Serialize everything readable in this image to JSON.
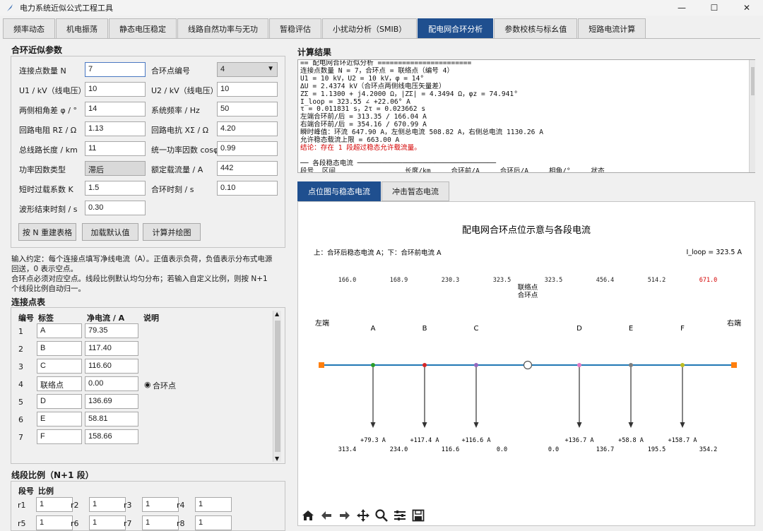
{
  "window": {
    "title": "电力系统近似公式工程工具",
    "buttons": [
      "minimize",
      "maximize",
      "close"
    ]
  },
  "tabs": [
    "频率动态",
    "机电振荡",
    "静态电压稳定",
    "线路自然功率与无功",
    "暂稳评估",
    "小扰动分析（SMIB）",
    "配电网合环分析",
    "参数校核与标幺值",
    "短路电流计算"
  ],
  "active_tab": "配电网合环分析",
  "params": {
    "title": "合环近似参数",
    "fields": [
      {
        "label": "连接点数量 N",
        "value": "7"
      },
      {
        "label": "合环点编号",
        "value": "4"
      },
      {
        "label": "U1 / kV（线电压）",
        "value": "10"
      },
      {
        "label": "U2 / kV（线电压）",
        "value": "10"
      },
      {
        "label": "两侧相角差 φ / °",
        "value": "14"
      },
      {
        "label": "系统频率 / Hz",
        "value": "50"
      },
      {
        "label": "回路电阻 RΣ / Ω",
        "value": "1.13"
      },
      {
        "label": "回路电抗 XΣ / Ω",
        "value": "4.20"
      },
      {
        "label": "总线路长度 / km",
        "value": "11"
      },
      {
        "label": "统一功率因数 cosφ",
        "value": "0.99"
      },
      {
        "label": "功率因数类型",
        "value": "滞后"
      },
      {
        "label": "额定载流量 / A",
        "value": "442"
      },
      {
        "label": "短时过载系数 K",
        "value": "1.5"
      },
      {
        "label": "合环时刻 / s",
        "value": "0.10"
      },
      {
        "label": "波形结束时刻 / s",
        "value": "0.30"
      }
    ],
    "buttons": [
      "按 N 重建表格",
      "加载默认值",
      "计算并绘图"
    ]
  },
  "note": [
    "输入约定：每个连接点填写净线电流（A）。正值表示负荷，负值表示分布式电源",
    "回送，0 表示空点。",
    "合环点必须对应空点。线段比例默认均匀分布；若输入自定义比例，则按 N+1",
    "个线段比例自动归一。"
  ],
  "nodes_table": {
    "title": "连接点表",
    "headers": [
      "编号",
      "标签",
      "净电流 / A",
      "说明"
    ],
    "rows": [
      {
        "no": "1",
        "label": "A",
        "current": "79.35",
        "desc": ""
      },
      {
        "no": "2",
        "label": "B",
        "current": "117.40",
        "desc": ""
      },
      {
        "no": "3",
        "label": "C",
        "current": "116.60",
        "desc": ""
      },
      {
        "no": "4",
        "label": "联络点",
        "current": "0.00",
        "desc": "合环点"
      },
      {
        "no": "5",
        "label": "D",
        "current": "136.69",
        "desc": ""
      },
      {
        "no": "6",
        "label": "E",
        "current": "58.81",
        "desc": ""
      },
      {
        "no": "7",
        "label": "F",
        "current": "158.66",
        "desc": ""
      }
    ]
  },
  "segments": {
    "title": "线段比例（N+1 段）",
    "headers": [
      "段号",
      "比例"
    ],
    "items": [
      {
        "label": "r1",
        "value": "1"
      },
      {
        "label": "r2",
        "value": "1"
      },
      {
        "label": "r3",
        "value": "1"
      },
      {
        "label": "r4",
        "value": "1"
      },
      {
        "label": "r5",
        "value": "1"
      },
      {
        "label": "r6",
        "value": "1"
      },
      {
        "label": "r7",
        "value": "1"
      },
      {
        "label": "r8",
        "value": "1"
      }
    ]
  },
  "results": {
    "title": "计算结果",
    "lines": [
      "== 配电网合环近似分析 =======================",
      "连接点数量 N = 7，合环点 = 联络点（编号 4）",
      "U1 = 10 kV，U2 = 10 kV，φ = 14°",
      "ΔU = 2.4374 kV（合环点两侧线电压矢量差）",
      "ZΣ = 1.1300 + j4.2000 Ω，|ZΣ| = 4.3494 Ω，φz = 74.941°",
      "I_loop = 323.55 ∠ +22.06° A",
      "τ = 0.011831 s，2τ = 0.023662 s",
      "左端合环前/后 = 313.35 / 166.04 A",
      "右端合环前/后 = 354.16 / 670.99 A",
      "瞬时峰值：环流 647.90 A，左侧总电流 508.82 A，右侧总电流 1130.26 A",
      "允许稳态载流上限 = 663.00 A",
      "结论：存在 1 段超过稳态允许载流量。",
      "",
      "── 各段稳态电流 ──────────────────────────────────",
      "段号  区间                 长度/km     合环前/A     合环后/A     相角/°     状态"
    ],
    "red_line_index": 11
  },
  "plot_tabs": [
    "点位图与稳态电流",
    "冲击暂态电流"
  ],
  "active_plot_tab": "点位图与稳态电流",
  "chart": {
    "title": "配电网合环点位示意与各段电流",
    "subtitle": "上：合环后稳态电流 A；下：合环前电流 A",
    "iloop": "I_loop = 323.5 A",
    "left_end": "左端",
    "right_end": "右端",
    "tie_label_1": "联络点",
    "tie_label_2": "合环点",
    "positions": [
      0,
      1,
      2,
      3,
      4,
      5,
      6,
      7,
      8
    ],
    "nodes": [
      {
        "label": "A",
        "color": "#2a9d2a",
        "current_label": "+79.3 A"
      },
      {
        "label": "B",
        "color": "#d62728",
        "current_label": "+117.4 A"
      },
      {
        "label": "C",
        "color": "#9467bd",
        "current_label": "+116.6 A"
      },
      {
        "label": "",
        "color": "#ffffff",
        "current_label": ""
      },
      {
        "label": "D",
        "color": "#e377c2",
        "current_label": "+136.7 A"
      },
      {
        "label": "E",
        "color": "#7f7f7f",
        "current_label": "+58.8 A"
      },
      {
        "label": "F",
        "color": "#bcbd22",
        "current_label": "+158.7 A"
      }
    ],
    "after_currents": [
      "166.0",
      "168.9",
      "230.3",
      "323.5",
      "323.5",
      "456.4",
      "514.2",
      "671.0"
    ],
    "before_currents": [
      "313.4",
      "234.0",
      "116.6",
      "0.0",
      "0.0",
      "136.7",
      "195.5",
      "354.2"
    ],
    "overload_index": 7,
    "line_color": "#1f77b4",
    "line_color_2": "#2ca02c",
    "end_color": "#ff7f0e",
    "overload_color": "#d40000"
  },
  "toolbar": [
    "home-icon",
    "back-icon",
    "forward-icon",
    "pan-icon",
    "zoom-icon",
    "configure-icon",
    "save-icon"
  ]
}
